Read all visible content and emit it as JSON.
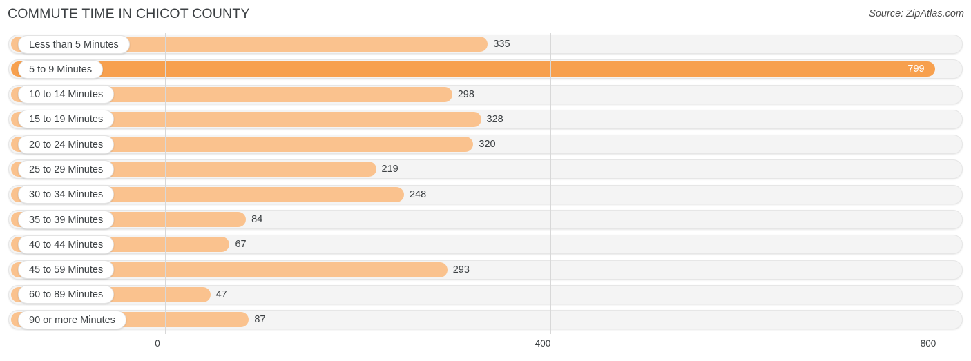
{
  "header": {
    "title": "COMMUTE TIME IN CHICOT COUNTY",
    "source": "Source: ZipAtlas.com"
  },
  "colors": {
    "bar": "#fac28e",
    "bar_highlight": "#f7a04e",
    "track": "#f4f4f4",
    "gridline": "#d8d8d8",
    "text": "#3c4043",
    "value_inside": "#ffffff"
  },
  "chart_data": {
    "type": "bar",
    "orientation": "horizontal",
    "title": "COMMUTE TIME IN CHICOT COUNTY",
    "subtitle": "",
    "xlabel": "",
    "ylabel": "",
    "source": "Source: ZipAtlas.com",
    "xlim": [
      0,
      800
    ],
    "xticks": [
      0,
      400,
      800
    ],
    "xtick_labels": [
      "0",
      "400",
      "800"
    ],
    "grid": true,
    "legend": false,
    "categories": [
      "Less than 5 Minutes",
      "5 to 9 Minutes",
      "10 to 14 Minutes",
      "15 to 19 Minutes",
      "20 to 24 Minutes",
      "25 to 29 Minutes",
      "30 to 34 Minutes",
      "35 to 39 Minutes",
      "40 to 44 Minutes",
      "45 to 59 Minutes",
      "60 to 89 Minutes",
      "90 or more Minutes"
    ],
    "values": [
      335,
      799,
      298,
      328,
      320,
      219,
      248,
      84,
      67,
      293,
      47,
      87
    ],
    "value_labels": [
      "335",
      "799",
      "298",
      "328",
      "320",
      "219",
      "248",
      "84",
      "67",
      "293",
      "47",
      "87"
    ],
    "highlight_index": 1
  }
}
